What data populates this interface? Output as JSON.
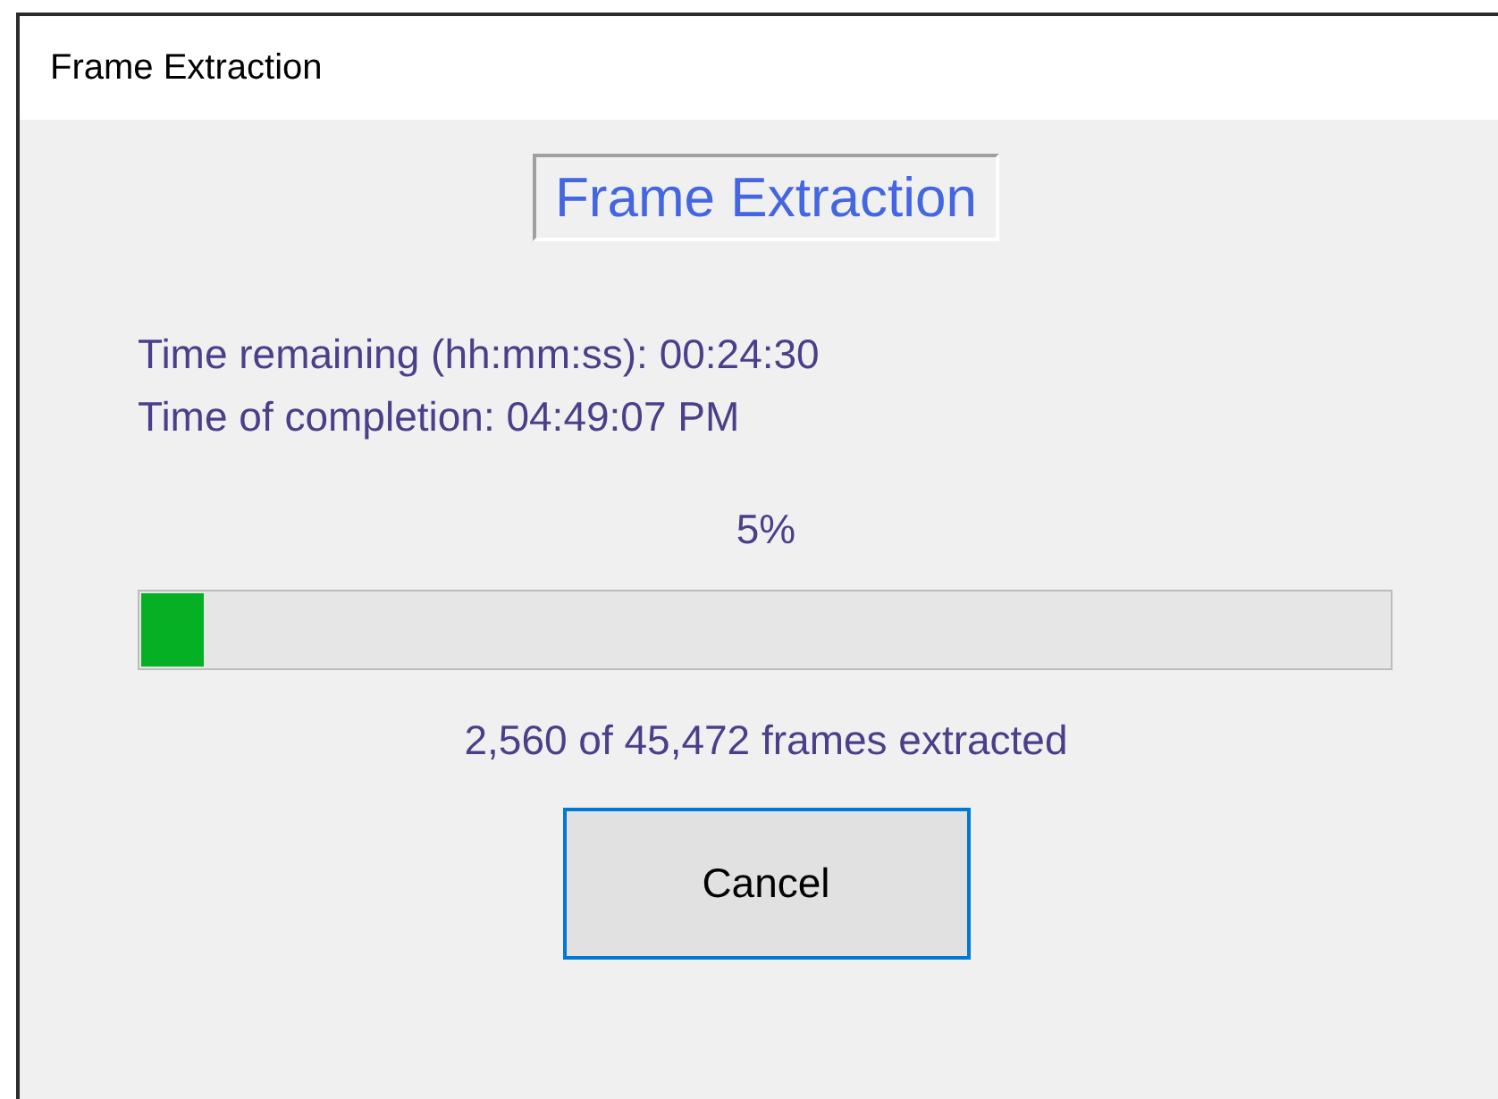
{
  "window": {
    "title": "Frame Extraction"
  },
  "heading": "Frame Extraction",
  "info_lines": [
    "Time remaining (hh:mm:ss): 00:24:30",
    "Time of completion: 04:49:07 PM"
  ],
  "percent": "5%",
  "progress": {
    "level": 0.05
  },
  "frames_status": "2,560 of 45,472 frames extracted",
  "buttons": [
    {
      "label": "Cancel",
      "focused": true
    }
  ]
}
